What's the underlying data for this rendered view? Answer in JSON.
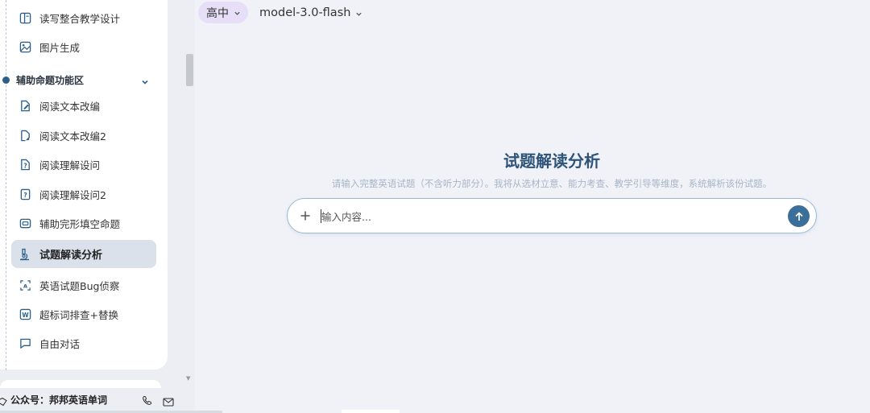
{
  "header": {
    "grade": "高中",
    "model": "model-3.0-flash"
  },
  "sidebar": {
    "items_top": [
      {
        "label": "读写整合教学设计",
        "icon": "book-layout-icon"
      },
      {
        "label": "图片生成",
        "icon": "image-icon"
      }
    ],
    "section": {
      "label": "辅助命题功能区",
      "icon": "chevron-down-icon"
    },
    "items": [
      {
        "label": "阅读文本改编",
        "icon": "edit-doc-icon"
      },
      {
        "label": "阅读文本改编2",
        "icon": "edit-doc2-icon"
      },
      {
        "label": "阅读理解设问",
        "icon": "question-doc-icon"
      },
      {
        "label": "阅读理解设问2",
        "icon": "question-doc2-icon"
      },
      {
        "label": "辅助完形填空命题",
        "icon": "cloze-icon"
      },
      {
        "label": "试题解读分析",
        "icon": "microscope-icon",
        "active": true
      },
      {
        "label": "英语试题Bug侦察",
        "icon": "scan-text-icon"
      },
      {
        "label": "超标词排查+替换",
        "icon": "word-doc-icon"
      },
      {
        "label": "自由对话",
        "icon": "chat-bubble-icon"
      }
    ],
    "footer": {
      "label": "公众号：邦邦英语单词"
    }
  },
  "main": {
    "title": "试题解读分析",
    "subtitle": "请输入完整英语试题（不含听力部分）。我将从选材立意、能力考查、教学引导等维度，系统解析该份试题。",
    "input_placeholder": "输入内容..."
  },
  "colors": {
    "accent": "#3b6e99",
    "title": "#2d5379",
    "grade_pill": "#e6dff7",
    "active_item": "#dbe1ea"
  }
}
